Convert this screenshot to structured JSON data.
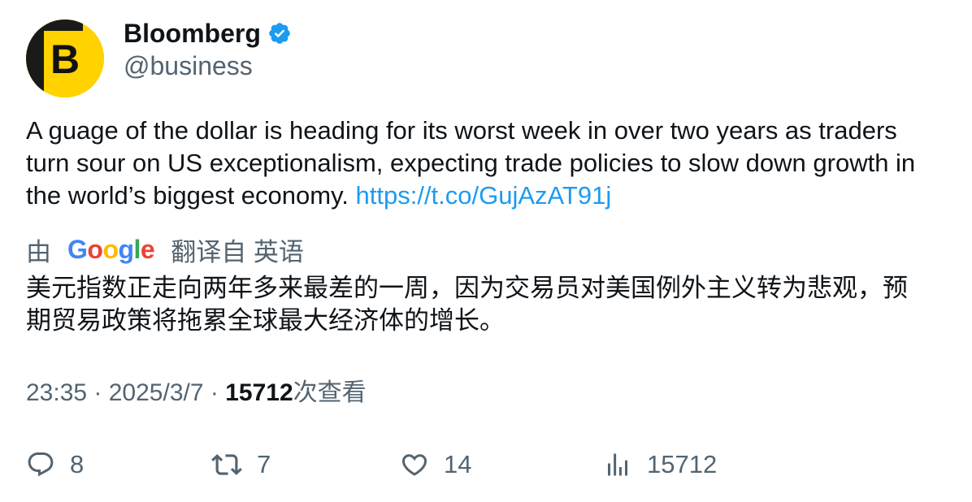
{
  "author": {
    "avatar_letter": "B",
    "display_name": "Bloomberg",
    "handle": "@business",
    "verified_icon": "verified-badge-icon"
  },
  "tweet": {
    "text": "A guage of the dollar is heading for its worst week in over two years as traders\nturn sour on US exceptionalism, expecting trade policies to slow down growth in\nthe world’s biggest economy. ",
    "link": "https://t.co/GujAzAT91j"
  },
  "translation": {
    "prefix": "由",
    "provider": "Google",
    "suffix": "翻译自 英语",
    "text": "美元指数正走向两年多来最差的一周，因为交易员对美国例外主义转为悲观，预\n期贸易政策将拖累全球最大经济体的增长。"
  },
  "meta": {
    "time": "23:35",
    "sep1": " · ",
    "date": "2025/3/7",
    "sep2": " · ",
    "views": "15712",
    "views_label": "次查看"
  },
  "actions": {
    "replies": "8",
    "retweets": "7",
    "likes": "14",
    "views": "15712"
  },
  "colors": {
    "brand_yellow": "#ffd200",
    "link_blue": "#1d9bf0",
    "secondary_text": "#536471",
    "primary_text": "#0f1419",
    "google_blue": "#4285f4",
    "google_red": "#ea4335",
    "google_yellow": "#fbbc05",
    "google_green": "#34a853"
  }
}
